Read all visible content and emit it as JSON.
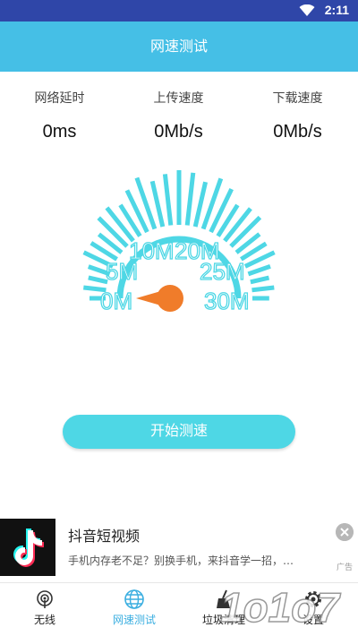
{
  "status_bar": {
    "time": "2:11"
  },
  "header": {
    "title": "网速测试"
  },
  "stats": [
    {
      "label": "网络延时",
      "value": "0ms"
    },
    {
      "label": "上传速度",
      "value": "0Mb/s"
    },
    {
      "label": "下载速度",
      "value": "0Mb/s"
    }
  ],
  "gauge": {
    "labels": [
      "0M",
      "5M",
      "10M",
      "20M",
      "25M",
      "30M"
    ],
    "current_value": "0"
  },
  "start_button": {
    "label": "开始测速"
  },
  "ad": {
    "title": "抖音短视频",
    "description": "手机内存老不足？别换手机，来抖音学一招，…",
    "tag": "广告"
  },
  "nav": {
    "items": [
      {
        "label": "无线",
        "icon": "wifi-radar-icon"
      },
      {
        "label": "网速测试",
        "icon": "globe-icon"
      },
      {
        "label": "垃圾清理",
        "icon": "broom-icon"
      },
      {
        "label": "设置",
        "icon": "gear-icon"
      }
    ],
    "active_index": 1
  },
  "watermark": {
    "text": "1o1o7"
  },
  "colors": {
    "status_bar": "#2f46a8",
    "header": "#45bfe6",
    "gauge": "#4ed7e5",
    "needle": "#f07c2a",
    "nav_active": "#3aaee0"
  }
}
